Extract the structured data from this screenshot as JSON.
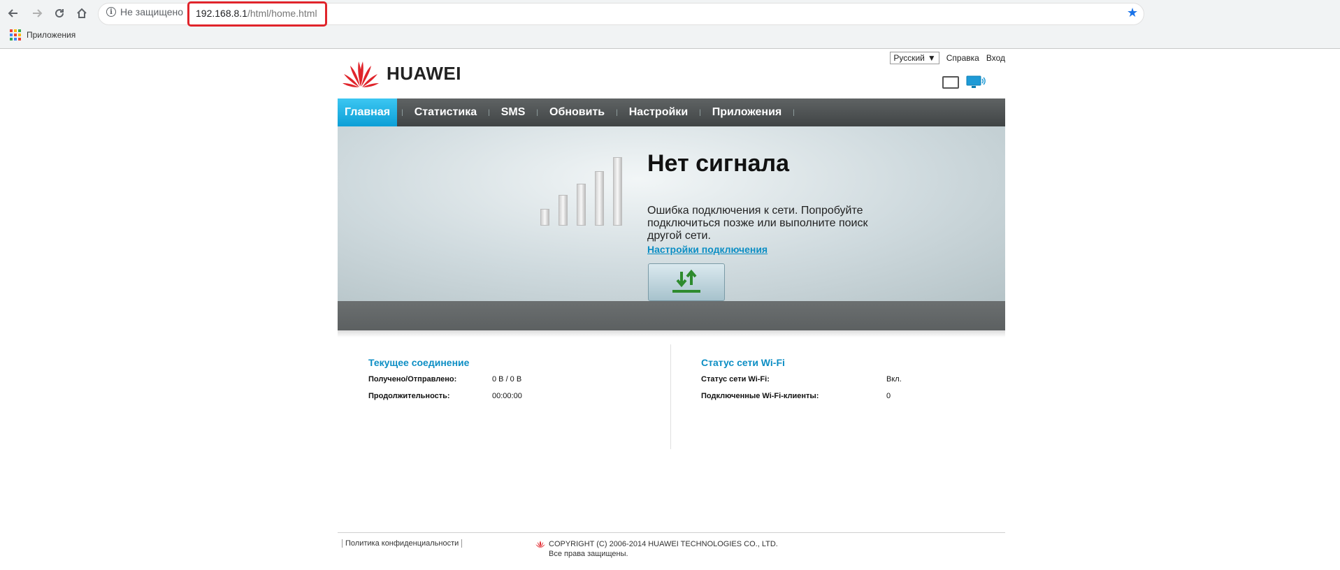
{
  "browser": {
    "security_label": "Не защищено",
    "url_host": "192.168.8.1",
    "url_path": "/html/home.html",
    "bookmark_apps": "Приложения"
  },
  "header": {
    "language": "Русский",
    "help": "Справка",
    "login": "Вход",
    "brand": "HUAWEI"
  },
  "nav": [
    {
      "label": "Главная"
    },
    {
      "label": "Статистика"
    },
    {
      "label": "SMS"
    },
    {
      "label": "Обновить"
    },
    {
      "label": "Настройки"
    },
    {
      "label": "Приложения"
    }
  ],
  "hero": {
    "title": "Нет сигнала",
    "message": "Ошибка подключения к сети. Попробуйте подключиться позже или выполните поиск другой сети.",
    "link": "Настройки подключения"
  },
  "connection": {
    "title": "Текущее соединение",
    "received_sent_label": "Получено/Отправлено:",
    "received_sent_value": "0 B /  0 B",
    "duration_label": "Продолжительность:",
    "duration_value": "00:00:00"
  },
  "wifi": {
    "title": "Статус сети Wi-Fi",
    "status_label": "Статус сети Wi-Fi:",
    "status_value": "Вкл.",
    "clients_label": "Подключенные Wi-Fi-клиенты:",
    "clients_value": "0"
  },
  "footer": {
    "privacy": "Политика конфиденциальности",
    "copyright": "COPYRIGHT (C) 2006-2014 HUAWEI TECHNOLOGIES CO., LTD.",
    "rights": "Все права защищены."
  },
  "colors": {
    "accent": "#0c9fd6",
    "link": "#0c8ec4",
    "brand_red": "#e0242b"
  },
  "icons": [
    "back-icon",
    "forward-icon",
    "reload-icon",
    "home-icon",
    "info-icon",
    "star-icon",
    "apps-icon",
    "huawei-logo-icon",
    "compact-view-icon",
    "monitor-view-icon",
    "signal-bars-icon",
    "connect-arrows-icon"
  ]
}
